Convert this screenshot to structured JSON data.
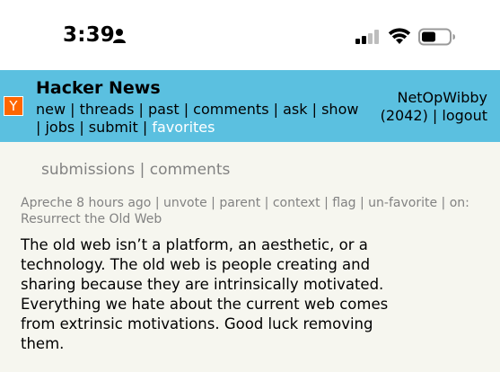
{
  "status_bar": {
    "time": "3:39",
    "icons": [
      "person-icon",
      "cellular-signal-icon",
      "wifi-icon",
      "battery-icon"
    ]
  },
  "header": {
    "logo_letter": "Y",
    "site_title": "Hacker News",
    "nav": [
      "new",
      "threads",
      "past",
      "comments",
      "ask",
      "show",
      "jobs",
      "submit",
      "favorites"
    ],
    "current": "favorites",
    "user": "NetOpWibby",
    "karma": "(2042)",
    "logout": "logout",
    "colors": {
      "bar": "#5bc0e0",
      "logo": "#ff6600",
      "current_link": "#ffffff"
    }
  },
  "subnav": {
    "submissions": "submissions",
    "comments": "comments"
  },
  "comment": {
    "author": "Apreche",
    "age": "8 hours ago",
    "links": [
      "unvote",
      "parent",
      "context",
      "flag",
      "un-favorite"
    ],
    "on_label": "on:",
    "story_title": "Resurrect the Old Web",
    "lines": [
      "The old web isn’t a platform, an aesthetic, or a",
      "technology. The old web is people creating and",
      "sharing because they are intrinsically motivated.",
      "Everything we hate about the current web comes",
      "from extrinsic motivations. Good luck removing",
      "them."
    ]
  }
}
